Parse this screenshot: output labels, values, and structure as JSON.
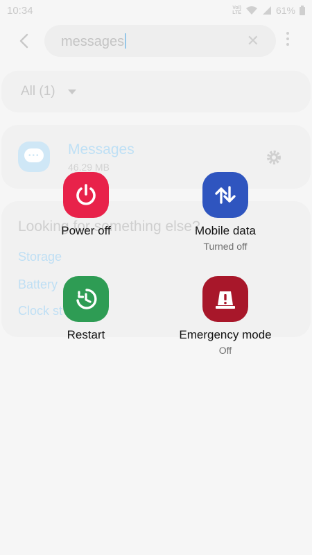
{
  "status_bar": {
    "time": "10:34",
    "volte_top": "Vol)",
    "volte_bottom": "LTE",
    "battery": "61%"
  },
  "search": {
    "query": "messages",
    "back_icon": "back-arrow-icon",
    "clear_icon": "close-icon",
    "more_icon": "more-vertical-icon"
  },
  "filter": {
    "label": "All (1)"
  },
  "result": {
    "app_name": "Messages",
    "app_size": "46.29 MB"
  },
  "looking": {
    "title": "Looking for something else?",
    "links": [
      "Storage",
      "Battery",
      "Clock st"
    ]
  },
  "power_menu": {
    "power_off": {
      "label": "Power off",
      "color": "#e8224a",
      "icon": "power-icon"
    },
    "mobile_data": {
      "label": "Mobile data",
      "status": "Turned off",
      "color": "#2f55bf",
      "icon": "data-arrows-icon"
    },
    "restart": {
      "label": "Restart",
      "color": "#2e9c54",
      "icon": "restart-icon"
    },
    "emergency": {
      "label": "Emergency mode",
      "status": "Off",
      "color": "#a8172a",
      "icon": "emergency-light-icon"
    }
  }
}
